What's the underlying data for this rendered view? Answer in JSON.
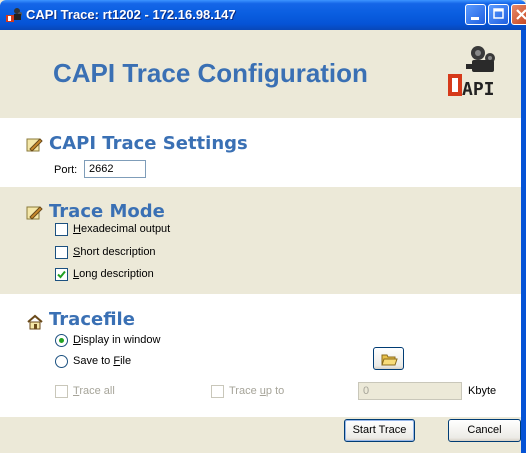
{
  "window": {
    "title": "CAPI Trace: rt1202 - 172.16.98.147"
  },
  "header": {
    "title": "CAPI Trace Configuration",
    "logo_text": "CAPI"
  },
  "settings": {
    "heading": "CAPI Trace Settings",
    "port_label": "Port:",
    "port_value": "2662"
  },
  "trace_mode": {
    "heading": "Trace Mode",
    "options": [
      {
        "label_u": "H",
        "label_rest": "exadecimal output",
        "checked": false
      },
      {
        "label_u": "S",
        "label_rest": "hort description",
        "checked": false
      },
      {
        "label_u": "L",
        "label_rest": "ong description",
        "checked": true
      }
    ]
  },
  "tracefile": {
    "heading": "Tracefile",
    "display_u": "D",
    "display_rest": "isplay in window",
    "save_pre": "Save to ",
    "save_u": "F",
    "save_rest": "ile",
    "trace_all_u": "T",
    "trace_all_rest": "race all",
    "trace_upto_pre": "Trace ",
    "trace_upto_u": "u",
    "trace_upto_rest": "p to",
    "upto_value": "0",
    "unit": "Kbyte"
  },
  "buttons": {
    "start": "Start Trace",
    "cancel": "Cancel"
  },
  "colors": {
    "heading": "#3a70b4",
    "titlebar": "#0a5ee0",
    "checkmark": "#21a121"
  }
}
